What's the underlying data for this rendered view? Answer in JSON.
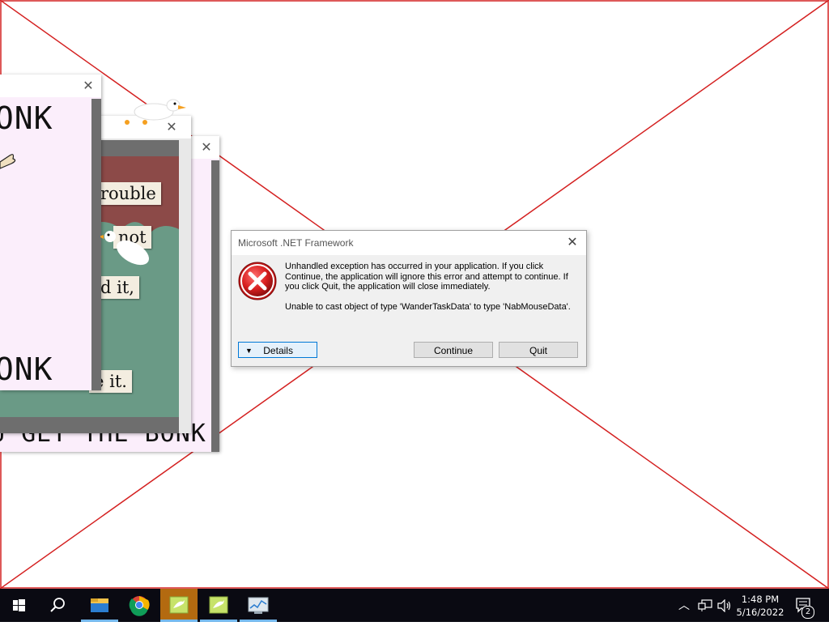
{
  "background_windows": {
    "honk_top": "HONK",
    "honk_bottom": "HONK",
    "bottom_caption": "U GET THE BONK",
    "notes": [
      "rouble",
      "not",
      "d it,",
      "e it."
    ]
  },
  "dialog": {
    "title": "Microsoft .NET Framework",
    "message_line1": "Unhandled exception has occurred in your application. If you click Continue, the application will ignore this error and attempt to continue. If you click Quit, the application will close immediately.",
    "message_line2": "Unable to cast object of type 'WanderTaskData' to type 'NabMouseData'.",
    "details_label": "Details",
    "continue_label": "Continue",
    "quit_label": "Quit",
    "icon": "error-icon"
  },
  "taskbar": {
    "icons": [
      "windows-start-icon",
      "search-icon",
      "file-explorer-icon",
      "chrome-icon",
      "goose-notes-icon",
      "goose-notes-icon-2",
      "task-manager-icon"
    ],
    "time": "1:48 PM",
    "date": "5/16/2022",
    "notification_count": "2"
  },
  "colors": {
    "placeholder_cross": "#d42020",
    "taskbar": "#0a0a12",
    "active_taskbar_item": "#b36a10",
    "error_red": "#d92020"
  }
}
